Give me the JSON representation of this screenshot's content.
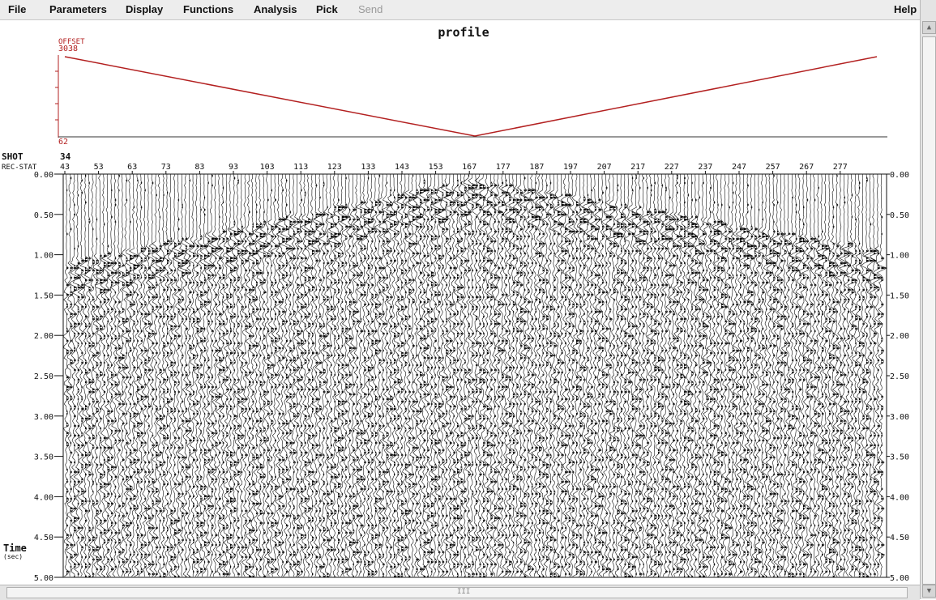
{
  "menu": {
    "file": "File",
    "parameters": "Parameters",
    "display": "Display",
    "functions": "Functions",
    "analysis": "Analysis",
    "pick": "Pick",
    "send": "Send",
    "help": "Help"
  },
  "profile": {
    "title": "profile",
    "offset_label": "OFFSET",
    "offset_max": "3038",
    "offset_min": "62",
    "offset_line_color": "#b32020"
  },
  "header": {
    "shot_label": "SHOT",
    "shot_value": "34",
    "recstat_label": "REC-STAT",
    "recstat_ticks": [
      "43",
      "53",
      "63",
      "73",
      "83",
      "93",
      "103",
      "113",
      "123",
      "133",
      "143",
      "153",
      "167",
      "177",
      "187",
      "197",
      "207",
      "217",
      "227",
      "237",
      "247",
      "257",
      "267",
      "277"
    ]
  },
  "time_axis": {
    "label": "Time",
    "unit": "(sec)",
    "ticks": [
      "0.00",
      "0.50",
      "1.00",
      "1.50",
      "2.00",
      "2.50",
      "3.00",
      "3.50",
      "4.00",
      "4.50",
      "5.00"
    ]
  },
  "scrollbar": {
    "grip": "III"
  }
}
